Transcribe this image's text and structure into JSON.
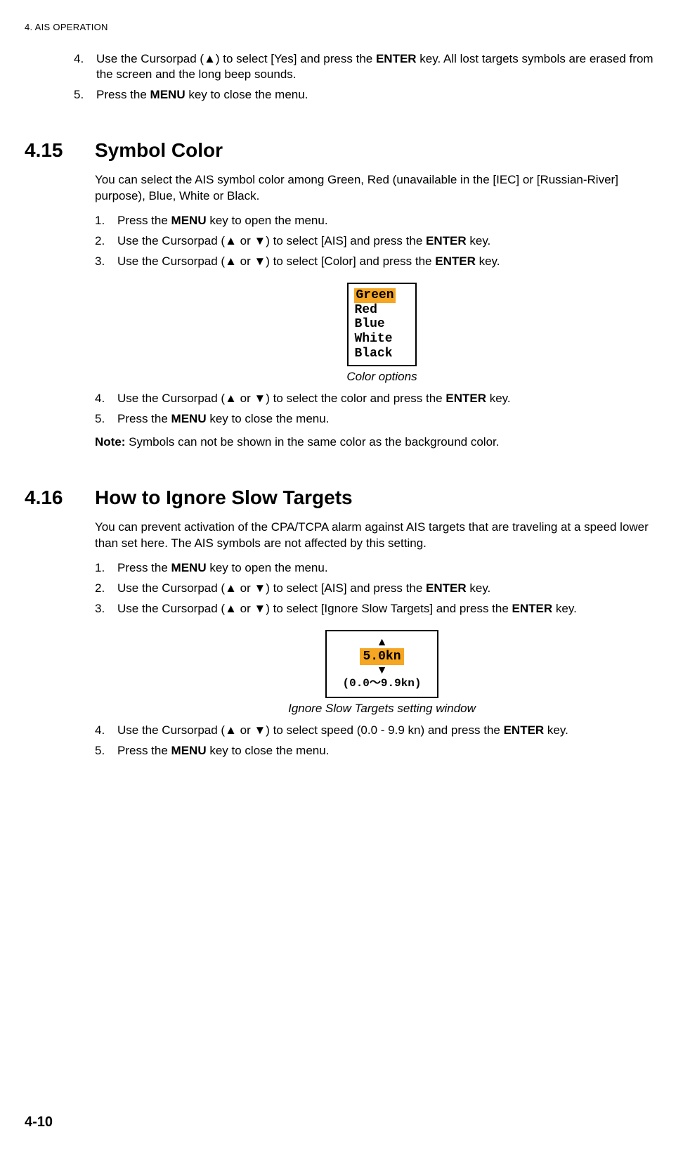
{
  "header": "4.  AIS OPERATION",
  "topSteps": {
    "s4": {
      "num": "4.",
      "text_a": "Use the Cursorpad (▲) to select [Yes] and press the ",
      "bold_a": "ENTER",
      "text_b": " key. All lost targets symbols are erased from the screen and the long beep sounds."
    },
    "s5": {
      "num": "5.",
      "text_a": "Press the ",
      "bold_a": "MENU",
      "text_b": " key to close the menu."
    }
  },
  "sec415": {
    "num": "4.15",
    "title": "Symbol Color",
    "intro": "You can select the AIS symbol color among Green, Red (unavailable in the [IEC] or [Russian-River] purpose), Blue, White or Black.",
    "steps": {
      "s1": {
        "num": "1.",
        "text_a": "Press the ",
        "bold_a": "MENU",
        "text_b": " key to open the menu."
      },
      "s2": {
        "num": "2.",
        "text_a": "Use the Cursorpad (▲ or ▼) to select [AIS] and press the ",
        "bold_a": "ENTER",
        "text_b": " key."
      },
      "s3": {
        "num": "3.",
        "text_a": "Use the Cursorpad (▲ or ▼) to select [Color] and press the ",
        "bold_a": "ENTER",
        "text_b": " key."
      },
      "s4": {
        "num": "4.",
        "text_a": "Use the Cursorpad (▲ or ▼) to select the color and press the ",
        "bold_a": "ENTER",
        "text_b": " key."
      },
      "s5": {
        "num": "5.",
        "text_a": "Press the ",
        "bold_a": "MENU",
        "text_b": " key to close the menu."
      }
    },
    "colors": {
      "c0": "Green",
      "c1": "Red",
      "c2": "Blue",
      "c3": "White",
      "c4": "Black"
    },
    "caption": "Color options",
    "note_a": "Note:",
    "note_b": " Symbols can not be shown in the same color as the background color."
  },
  "sec416": {
    "num": "4.16",
    "title": "How to Ignore Slow Targets",
    "intro": "You can prevent activation of the CPA/TCPA alarm against AIS targets that are traveling at a speed lower than set here. The AIS symbols are not affected by this setting.",
    "steps": {
      "s1": {
        "num": "1.",
        "text_a": "Press the ",
        "bold_a": "MENU",
        "text_b": " key to open the menu."
      },
      "s2": {
        "num": "2.",
        "text_a": "Use the Cursorpad (▲ or ▼) to select [AIS] and press the ",
        "bold_a": "ENTER",
        "text_b": " key."
      },
      "s3": {
        "num": "3.",
        "text_a": "Use the Cursorpad (▲ or ▼) to select [Ignore Slow Targets] and press the ",
        "bold_a": "ENTER",
        "text_b": " key."
      },
      "s4": {
        "num": "4.",
        "text_a": "Use the Cursorpad (▲ or ▼) to select speed (0.0 - 9.9 kn) and press the ",
        "bold_a": "ENTER",
        "text_b": " key."
      },
      "s5": {
        "num": "5.",
        "text_a": "Press the ",
        "bold_a": "MENU",
        "text_b": " key to close the menu."
      }
    },
    "speed": {
      "value": "5.0kn",
      "range": "(0.0～9.9kn)"
    },
    "caption": "Ignore Slow Targets setting window"
  },
  "pageNum": "4-10"
}
